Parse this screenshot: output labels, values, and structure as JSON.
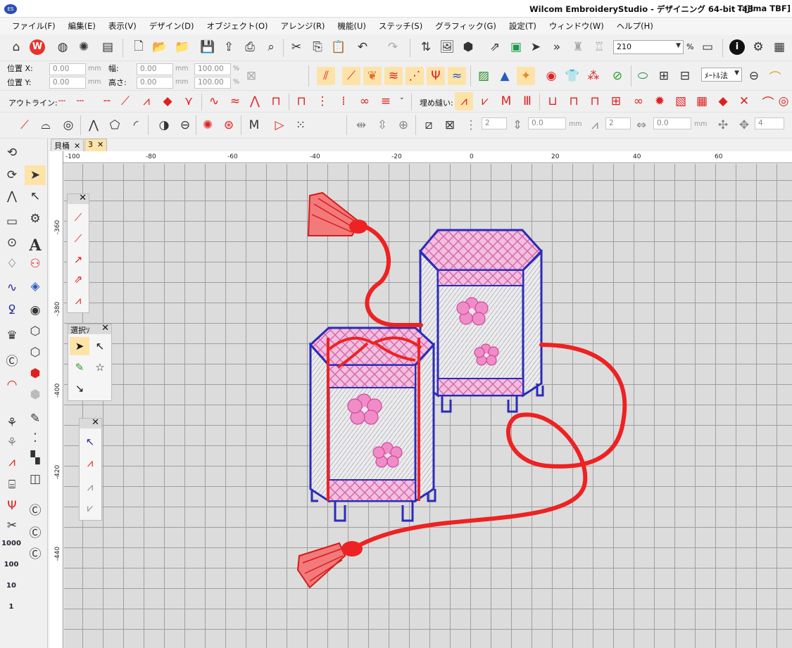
{
  "window": {
    "title": "Wilcom EmbroideryStudio - デザイニング 64-bit - [3",
    "title_right": "Tajima TBF]"
  },
  "menu": [
    "ファイル(F)",
    "編集(E)",
    "表示(V)",
    "デザイン(D)",
    "オブジェクト(O)",
    "アレンジ(R)",
    "機能(U)",
    "ステッチ(S)",
    "グラフィック(G)",
    "設定(T)",
    "ウィンドウ(W)",
    "ヘルプ(H)"
  ],
  "toolbar": {
    "zoom_value": "210",
    "zoom_unit": "%",
    "measure_label": "ﾒｰﾄﾙ法",
    "pos_x_label": "位置 X:",
    "pos_y_label": "位置 Y:",
    "width_label": "幅:",
    "height_label": "高さ:",
    "pos_x_value": "0.00",
    "pos_y_value": "0.00",
    "width_value": "0.00",
    "height_value": "0.00",
    "width_pct": "100.00",
    "height_pct": "100.00",
    "mm": "mm",
    "pct": "%",
    "outline_label": "アウトライン:",
    "fill_label": "埋め縫い:",
    "num1": "2",
    "num2": "0.0",
    "num3": "2",
    "num4": "0.0",
    "num5": "4"
  },
  "tabs": [
    {
      "label": "貝桶"
    },
    {
      "label": "3"
    }
  ],
  "ruler": {
    "h": [
      "-100",
      "-80",
      "-60",
      "-40",
      "-20",
      "0",
      "20",
      "40",
      "60"
    ],
    "v": [
      "-360",
      "-380",
      "-400",
      "-420",
      "-440"
    ]
  },
  "left_labels": [
    "1000",
    "100",
    "10",
    "1"
  ],
  "panels": {
    "select_title": "選択ｿ"
  },
  "colors": {
    "accent": "#fde3a8",
    "thread_red": "#ee2222",
    "thread_blue": "#2b2bb8",
    "thread_pink": "#f0a0d0"
  }
}
